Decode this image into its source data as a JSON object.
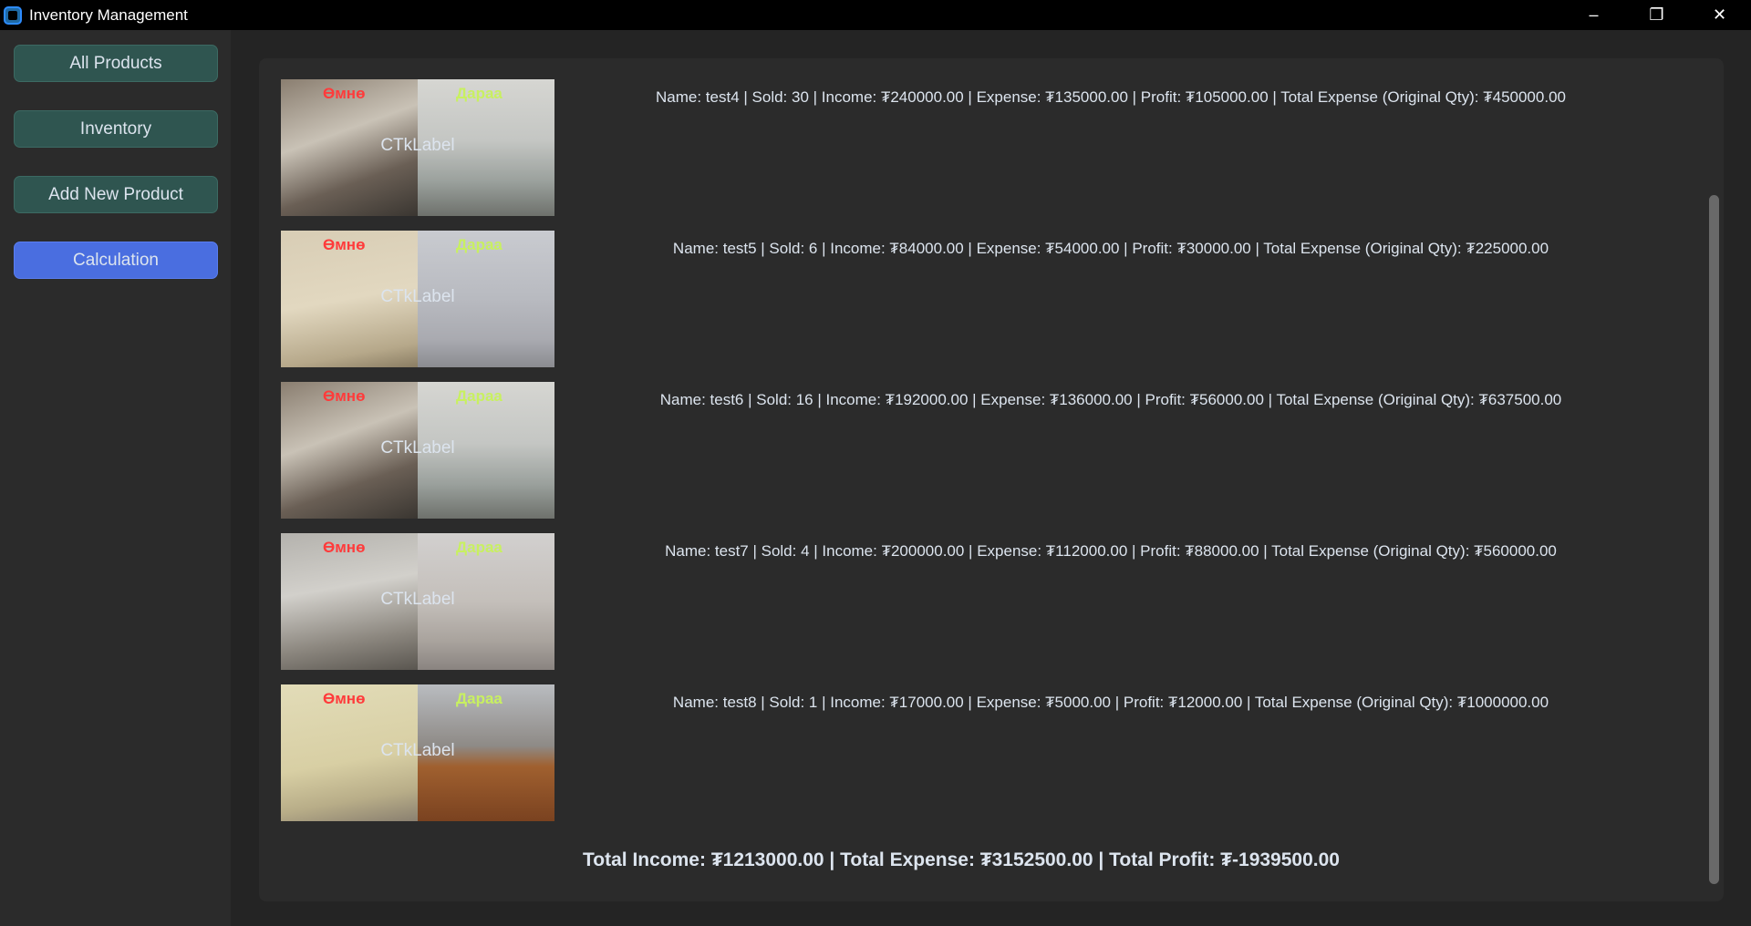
{
  "window": {
    "title": "Inventory Management"
  },
  "sidebar": {
    "items": [
      {
        "label": "All Products"
      },
      {
        "label": "Inventory"
      },
      {
        "label": "Add New Product"
      },
      {
        "label": "Calculation"
      }
    ]
  },
  "products": [
    {
      "before": "Өмнө",
      "after": "Дараа",
      "image_label": "CTkLabel",
      "info": "Name: test4 | Sold: 30 | Income: ₮240000.00 | Expense: ₮135000.00 | Profit: ₮105000.00 | Total Expense (Original Qty): ₮450000.00"
    },
    {
      "before": "Өмнө",
      "after": "Дараа",
      "image_label": "CTkLabel",
      "info": "Name: test5 | Sold: 6 | Income: ₮84000.00 | Expense: ₮54000.00 | Profit: ₮30000.00 | Total Expense (Original Qty): ₮225000.00"
    },
    {
      "before": "Өмнө",
      "after": "Дараа",
      "image_label": "CTkLabel",
      "info": "Name: test6 | Sold: 16 | Income: ₮192000.00 | Expense: ₮136000.00 | Profit: ₮56000.00 | Total Expense (Original Qty): ₮637500.00"
    },
    {
      "before": "Өмнө",
      "after": "Дараа",
      "image_label": "CTkLabel",
      "info": "Name: test7 | Sold: 4 | Income: ₮200000.00 | Expense: ₮112000.00 | Profit: ₮88000.00 | Total Expense (Original Qty): ₮560000.00"
    },
    {
      "before": "Өмнө",
      "after": "Дараа",
      "image_label": "CTkLabel",
      "info": "Name: test8 | Sold: 1 | Income: ₮17000.00 | Expense: ₮5000.00 | Profit: ₮12000.00 | Total Expense (Original Qty): ₮1000000.00"
    }
  ],
  "totals": "Total Income: ₮1213000.00 | Total Expense: ₮3152500.00 | Total Profit: ₮-1939500.00",
  "colors": {
    "active_button": "#4a6ee0",
    "nav_button": "#2f5550",
    "before_tag": "#ff3b3b",
    "after_tag": "#c8f060"
  }
}
